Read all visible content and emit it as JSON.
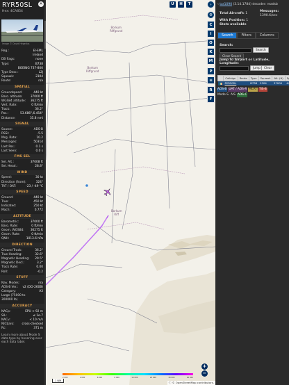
{
  "info": {
    "callsign": "RYR50SL",
    "hex_line": "Hex: 4CA854",
    "photo_credit": "Image © David Hegedus",
    "rows_top": [
      {
        "k": "Reg.:",
        "v": "EI-EML"
      },
      {
        "k": "",
        "v": "Ireland"
      },
      {
        "k": "DB flags:",
        "v": "none"
      },
      {
        "k": "Type:",
        "v": "B738"
      },
      {
        "k": "",
        "v": "BOEING 737-800"
      },
      {
        "k": "Type Desc.:",
        "v": "L2J"
      },
      {
        "k": "Squawk:",
        "v": "2304"
      },
      {
        "k": "Route:",
        "v": "n/a"
      }
    ],
    "spatial_title": "SPATIAL",
    "spatial": [
      {
        "k": "Groundspeed:",
        "v": "440 kt"
      },
      {
        "k": "Baro. altitude:",
        "v": "37000 ft"
      },
      {
        "k": "WGS84 altitude:",
        "v": "36275 ft"
      },
      {
        "k": "Vert. Rate:",
        "v": "0 ft/min"
      },
      {
        "k": "Track:",
        "v": "36.2°"
      },
      {
        "k": "Pos.:",
        "v": "53.686°,6.454°"
      },
      {
        "k": "Distance:",
        "v": "35.8 nmi"
      }
    ],
    "signal_title": "SIGNAL",
    "signal": [
      {
        "k": "Source:",
        "v": "ADS-B"
      },
      {
        "k": "RSSI:",
        "v": "-5.5"
      },
      {
        "k": "Msg. Rate:",
        "v": "10.2"
      },
      {
        "k": "Messages:",
        "v": "50314"
      },
      {
        "k": "Last Pos.:",
        "v": "0.1 s"
      },
      {
        "k": "Last Seen:",
        "v": "0.0 s"
      }
    ],
    "fms_title": "FMS SEL",
    "fms": [
      {
        "k": "Sel. Alt.:",
        "v": "37008 ft"
      },
      {
        "k": "Sel. Head.:",
        "v": "28.8°"
      }
    ],
    "wind_title": "WIND",
    "wind": [
      {
        "k": "Speed:",
        "v": "30 kt"
      },
      {
        "k": "Direction (from):",
        "v": "324°"
      },
      {
        "k": "TAT / OAT:",
        "v": "-23 / -49 °C"
      }
    ],
    "speed_title": "SPEED",
    "speed": [
      {
        "k": "Ground:",
        "v": "440 kt"
      },
      {
        "k": "True:",
        "v": "450 kt"
      },
      {
        "k": "Indicated:",
        "v": "250 kt"
      },
      {
        "k": "Mach:",
        "v": "0.772"
      }
    ],
    "altitude_title": "ALTITUDE",
    "altitude": [
      {
        "k": "Barometric:",
        "v": "37000 ft"
      },
      {
        "k": "Baro. Rate:",
        "v": "0 ft/min"
      },
      {
        "k": "Geom. WGS84:",
        "v": "36275 ft"
      },
      {
        "k": "Geom. Rate:",
        "v": "0 ft/min"
      },
      {
        "k": "QNH:",
        "v": "1013.6 hPa"
      }
    ],
    "direction_title": "DIRECTION",
    "direction": [
      {
        "k": "Ground Track:",
        "v": "36.2°"
      },
      {
        "k": "True Heading:",
        "v": "32.6°"
      },
      {
        "k": "Magnetic Heading:",
        "v": "29.5°"
      },
      {
        "k": "Magnetic Decl.:",
        "v": "3.2°"
      },
      {
        "k": "Track Rate:",
        "v": "0.00"
      },
      {
        "k": "Roll:",
        "v": "-0.2"
      }
    ],
    "stuff_title": "STUFF",
    "stuff": [
      {
        "k": "Nav. Modes:",
        "v": "n/a"
      },
      {
        "k": "ADS-B Ver.:",
        "v": "v2 (DO-260B)"
      },
      {
        "k": "Category:",
        "v": "A3"
      },
      {
        "k": "Large (75000 to",
        "v": ""
      },
      {
        "k": "300000 lb)",
        "v": ""
      }
    ],
    "accuracy_title": "ACCURACY",
    "accuracy": [
      {
        "k": "NACp:",
        "v": "EPU < 92 m"
      },
      {
        "k": "SIL:",
        "v": "≤ 1e-7"
      },
      {
        "k": "NACv:",
        "v": "< 10 m/s"
      },
      {
        "k": "NICbaro:",
        "v": "cross-checked"
      },
      {
        "k": "Rc:",
        "v": "371 m"
      }
    ],
    "learn_more": "Learn more about Mode S data type by hovering over each data label."
  },
  "map": {
    "top_buttons": [
      "U",
      "H",
      "T"
    ],
    "side_buttons": [
      "C",
      "I",
      "O",
      "K",
      "M",
      "P",
      "R",
      "F"
    ],
    "zoom_in": "+",
    "zoom_out": "−",
    "labels": [
      {
        "name": "map-label-area-1",
        "text": "Borkum\nRiffgrund"
      },
      {
        "name": "map-label-area-2",
        "text": "Borkum\nRiff"
      },
      {
        "name": "map-label-area-3",
        "text": "Borkum\nRiffgrund"
      }
    ],
    "scale_label": "1 NM",
    "altitude_ticks": [
      "2 000",
      "4 000",
      "6 000",
      "8 000",
      "10 000",
      "20 000",
      "30 000",
      "40 000"
    ],
    "attribution": "© OpenStreetMap contributors."
  },
  "right": {
    "decoder_prefix": "",
    "decoder_link": "tar1090",
    "decoder_suffix": " (3.14.1784) decoder: readsb",
    "total_aircraft_label": "Total Aircraft:",
    "total_aircraft": "1",
    "messages_label": "Messages:",
    "messages_value": "1390.6/sec",
    "with_position_label": "With Position:",
    "with_position": "1",
    "stats_label": "Stats available",
    "tabs": [
      "Search",
      "Filters",
      "Columns"
    ],
    "search_label": "Search:",
    "search_button": "Search",
    "clear_search": "Clear Search",
    "jump_label": "Jump to Airport or Latitude, Longitude:",
    "jump_button": "Jump",
    "clear_button": "Clear",
    "table_headers": [
      "",
      "Callsign",
      "Route",
      "Type",
      "Squawk",
      "Alt. (ft)",
      "Spd."
    ],
    "table_rows": [
      {
        "flag": "",
        "callsign": "RYR50SL",
        "route": "",
        "type": "B738",
        "squawk": "2304",
        "alt": "37000",
        "spd": "440"
      }
    ],
    "legend_row1": [
      {
        "t": "ADS-B",
        "c": "#1f4e80",
        "fg": "#fff"
      },
      {
        "t": "UAT / ADS-R",
        "c": "#5a3a66",
        "fg": "#fff"
      },
      {
        "t": "MLAT",
        "c": "#b9a24a",
        "fg": "#222"
      },
      {
        "t": "TIS-B",
        "c": "#b5453a",
        "fg": "#fff"
      }
    ],
    "legend_row2": [
      {
        "t": "Mode-S",
        "c": "#2b2b2b",
        "fg": "#ddd"
      },
      {
        "t": "AIS",
        "c": "#2b2b2b",
        "fg": "#ddd"
      },
      {
        "t": "ADS-C",
        "c": "#2d6b3a",
        "fg": "#fff"
      }
    ],
    "colors": {
      "accent": "#1d78d0",
      "selected_row": "#1f4e80"
    }
  }
}
